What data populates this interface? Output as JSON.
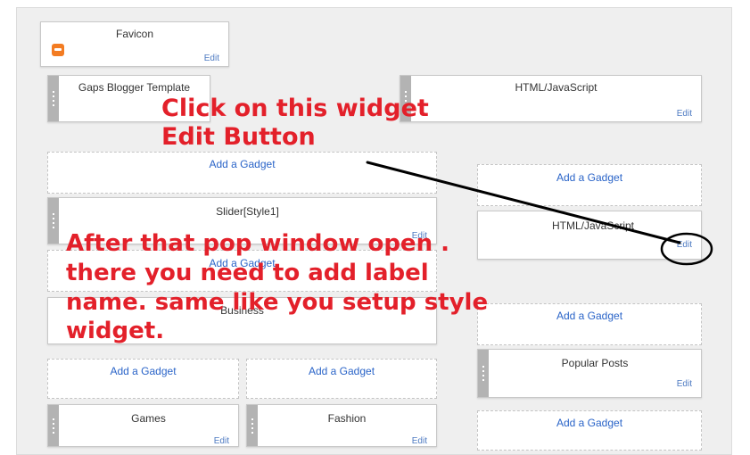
{
  "widgets": {
    "favicon": {
      "title": "Favicon",
      "edit": "Edit"
    },
    "gaps_template": {
      "title": "Gaps Blogger Template"
    },
    "html_js_top": {
      "title": "HTML/JavaScript",
      "edit": "Edit"
    },
    "slider": {
      "title": "Slider[Style1]",
      "edit": "Edit"
    },
    "html_js_right": {
      "title": "HTML/JavaScript",
      "edit": "Edit"
    },
    "business": {
      "title": "Business"
    },
    "popular_posts": {
      "title": "Popular Posts",
      "edit": "Edit"
    },
    "games": {
      "title": "Games",
      "edit": "Edit"
    },
    "fashion": {
      "title": "Fashion",
      "edit": "Edit"
    }
  },
  "add_gadget_label": "Add a Gadget",
  "annotations": {
    "top_line1": "Click on this widget",
    "top_line2": "Edit Button",
    "bottom_line1": "After that pop window open .",
    "bottom_line2": "there you need to add label",
    "bottom_line3": "name. same like you setup style",
    "bottom_line4": "widget."
  },
  "colors": {
    "annotation": "#e3202a",
    "link": "#2a64c8",
    "edit": "#4d7ac2",
    "handle": "#b3b3b3"
  }
}
